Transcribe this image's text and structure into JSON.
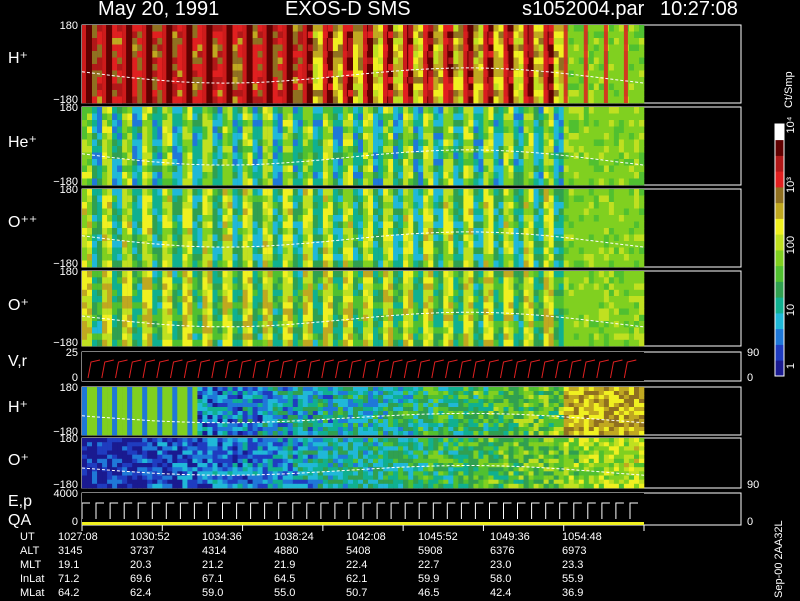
{
  "header": {
    "date": "May 20, 1991",
    "instrument": "EXOS-D SMS",
    "file": "s1052004.par",
    "time": "10:27:08"
  },
  "footer_label": "Sep-00 2AA32L",
  "colorbar": {
    "unit_label": "Ct/Smp",
    "ticks": [
      "1",
      "10",
      "100",
      "10³",
      "10⁴"
    ],
    "colors": [
      "#1a1a90",
      "#1f3cc0",
      "#1f78d8",
      "#20b8d8",
      "#10b090",
      "#30a050",
      "#50c030",
      "#80d020",
      "#c0e020",
      "#f0f020",
      "#c0a820",
      "#907020",
      "#e02020",
      "#b01818",
      "#600000",
      "#ffffff"
    ]
  },
  "time_axis": {
    "labels": [
      "1027:08",
      "1030:52",
      "1034:36",
      "1038:24",
      "1042:08",
      "1045:52",
      "1049:36",
      "1054:48"
    ]
  },
  "ephemeris": [
    {
      "name": "UT",
      "values": [
        "1027:08",
        "1030:52",
        "1034:36",
        "1038:24",
        "1042:08",
        "1045:52",
        "1049:36",
        "1054:48"
      ]
    },
    {
      "name": "ALT",
      "values": [
        "3145",
        "3737",
        "4314",
        "4880",
        "5408",
        "5908",
        "6376",
        "6973"
      ]
    },
    {
      "name": "MLT",
      "values": [
        "19.1",
        "20.3",
        "21.2",
        "21.9",
        "22.4",
        "22.7",
        "23.0",
        "23.3"
      ]
    },
    {
      "name": "InLat",
      "values": [
        "71.2",
        "69.6",
        "67.1",
        "64.5",
        "62.1",
        "59.9",
        "58.0",
        "55.9"
      ]
    },
    {
      "name": "MLat",
      "values": [
        "64.2",
        "62.4",
        "59.0",
        "55.0",
        "50.7",
        "46.5",
        "42.4",
        "36.9"
      ]
    }
  ],
  "panels": [
    {
      "label": "H⁺",
      "ymax": "180",
      "ymin": "−180",
      "base": 0.75,
      "style": "pitch"
    },
    {
      "label": "He⁺",
      "ymax": "180",
      "ymin": "−180",
      "base": 0.35,
      "style": "pitch"
    },
    {
      "label": "O⁺⁺",
      "ymax": "180",
      "ymin": "−180",
      "base": 0.4,
      "style": "pitch"
    },
    {
      "label": "O⁺",
      "ymax": "180",
      "ymin": "−180",
      "base": 0.45,
      "style": "pitch"
    },
    {
      "label": "V,r",
      "ymax": "25",
      "ymin": "0",
      "right_top": "90",
      "right_bottom": "0",
      "style": "vr"
    },
    {
      "label": "H⁺",
      "ymax": "180",
      "ymin": "−180",
      "base": 0.2,
      "style": "pitch2"
    },
    {
      "label": "O⁺",
      "ymax": "180",
      "ymin": "−180",
      "base": 0.25,
      "style": "pitch3",
      "right_bottom": "90"
    },
    {
      "label": "E,p\nQA",
      "ymax": "4000",
      "ymin": "0",
      "right_bottom": "0",
      "style": "ep"
    }
  ]
}
